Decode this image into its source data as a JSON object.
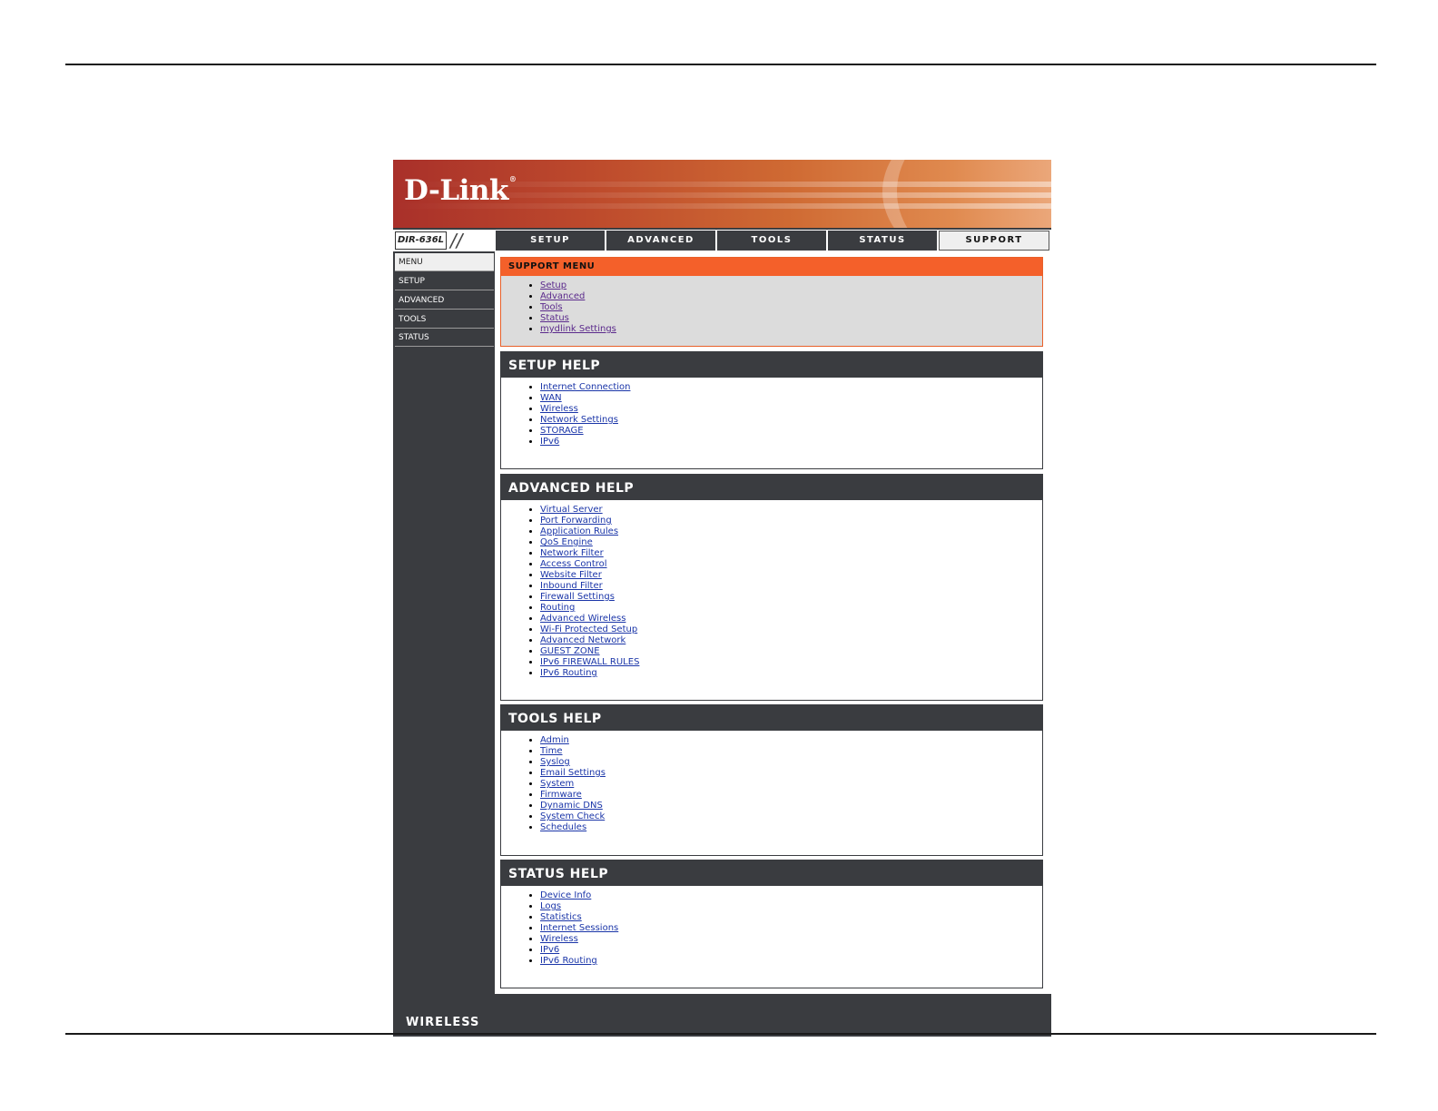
{
  "header": {
    "brand": "D-Link",
    "brand_mark": "®"
  },
  "navbar": {
    "model": "DIR-636L",
    "tabs": [
      {
        "label": "SETUP",
        "active": false
      },
      {
        "label": "ADVANCED",
        "active": false
      },
      {
        "label": "TOOLS",
        "active": false
      },
      {
        "label": "STATUS",
        "active": false
      },
      {
        "label": "SUPPORT",
        "active": true
      }
    ]
  },
  "sidebar": {
    "items": [
      {
        "label": "MENU",
        "active": true
      },
      {
        "label": "SETUP",
        "active": false
      },
      {
        "label": "ADVANCED",
        "active": false
      },
      {
        "label": "TOOLS",
        "active": false
      },
      {
        "label": "STATUS",
        "active": false
      }
    ]
  },
  "support_menu": {
    "title": "SUPPORT MENU",
    "links": [
      "Setup",
      "Advanced",
      "Tools",
      "Status",
      "mydlink Settings"
    ]
  },
  "setup_help": {
    "title": "SETUP HELP",
    "links": [
      "Internet Connection",
      "WAN",
      "Wireless",
      "Network Settings",
      "STORAGE",
      "IPv6"
    ]
  },
  "advanced_help": {
    "title": "ADVANCED HELP",
    "links": [
      "Virtual Server",
      "Port Forwarding",
      "Application Rules",
      "QoS Engine",
      "Network Filter",
      "Access Control",
      "Website Filter",
      "Inbound Filter",
      "Firewall Settings",
      "Routing",
      "Advanced Wireless",
      "Wi-Fi Protected Setup",
      "Advanced Network",
      "GUEST ZONE",
      "IPv6 FIREWALL RULES",
      "IPv6 Routing"
    ]
  },
  "tools_help": {
    "title": "TOOLS HELP",
    "links": [
      "Admin",
      "Time",
      "Syslog",
      "Email Settings",
      "System",
      "Firmware",
      "Dynamic DNS",
      "System Check",
      "Schedules"
    ]
  },
  "status_help": {
    "title": "STATUS HELP",
    "links": [
      "Device Info",
      "Logs",
      "Statistics",
      "Internet Sessions",
      "Wireless",
      "IPv6",
      "IPv6 Routing"
    ]
  },
  "footer": {
    "brand": "WIRELESS"
  },
  "colors": {
    "accent": "#f4602a",
    "dark": "#3a3c40",
    "link": "#1a35a8",
    "visited_link": "#5b2a8c"
  }
}
